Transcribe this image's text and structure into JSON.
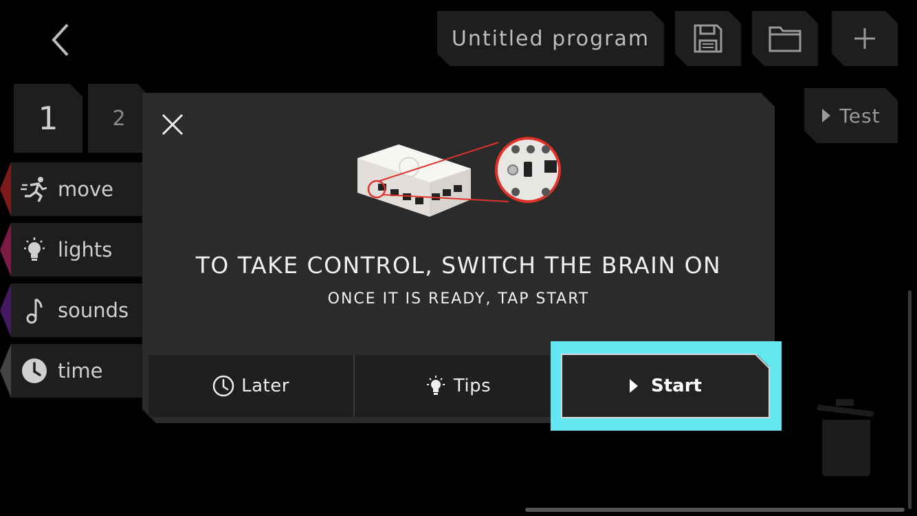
{
  "header": {
    "program_title": "Untitled program"
  },
  "pages": {
    "tab1": "1",
    "tab2": "2"
  },
  "categories": [
    {
      "label": "move",
      "color": "#8e1b1b"
    },
    {
      "label": "lights",
      "color": "#8a1d4c"
    },
    {
      "label": "sounds",
      "color": "#4a1c6e"
    },
    {
      "label": "time",
      "color": "#4a4a4a"
    }
  ],
  "toolbar": {
    "test_label": "Test"
  },
  "dialog": {
    "heading": "TO TAKE CONTROL, SWITCH THE BRAIN ON",
    "subheading": "ONCE IT IS READY, TAP START",
    "later_label": "Later",
    "tips_label": "Tips",
    "start_label": "Start"
  },
  "colors": {
    "highlight": "#63e6f0",
    "callout_red": "#e0322a"
  }
}
